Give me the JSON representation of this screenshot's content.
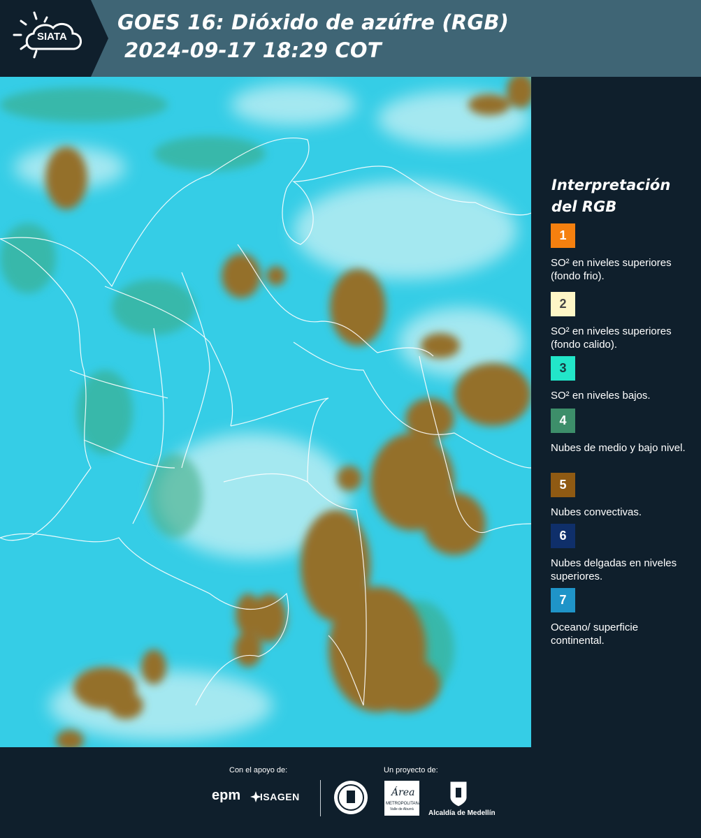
{
  "header": {
    "logo_text": "SIATA",
    "title_line1": "GOES 16: Dióxido de azúfre (RGB)",
    "title_line2": "2024-09-17 18:29 COT",
    "background": "#3f6575"
  },
  "legend": {
    "title": "Interpretación del RGB",
    "items": [
      {
        "number": "1",
        "color": "#f5800f",
        "label": "SO² en niveles superiores (fondo frio)."
      },
      {
        "number": "2",
        "color": "#fef6c6",
        "label": "SO² en niveles superiores (fondo calido)."
      },
      {
        "number": "3",
        "color": "#22e6c9",
        "label": "SO² en niveles bajos."
      },
      {
        "number": "4",
        "color": "#3d8e6a",
        "label": "Nubes de medio y bajo nivel."
      },
      {
        "number": "5",
        "color": "#8f5a13",
        "label": "Nubes convectivas."
      },
      {
        "number": "6",
        "color": "#0f2f6a",
        "label": "Nubes delgadas en niveles superiores."
      },
      {
        "number": "7",
        "color": "#1f94c8",
        "label": "Oceano/ superficie continental."
      }
    ]
  },
  "footer": {
    "support_label": "Con el apoyo de:",
    "project_label": "Un proyecto de:",
    "sponsor1": "epm",
    "sponsor2": "ISAGEN",
    "partner_alcaldia": "Alcaldía de Medellín",
    "partner_area": "Área",
    "partner_area_sub": "METROPOLITANA",
    "partner_area_sub2": "Valle de Aburrá"
  },
  "colors": {
    "ocean": "#33cfe8",
    "convective": "#8f6a1e",
    "sidebar": "#0f1f2c"
  }
}
